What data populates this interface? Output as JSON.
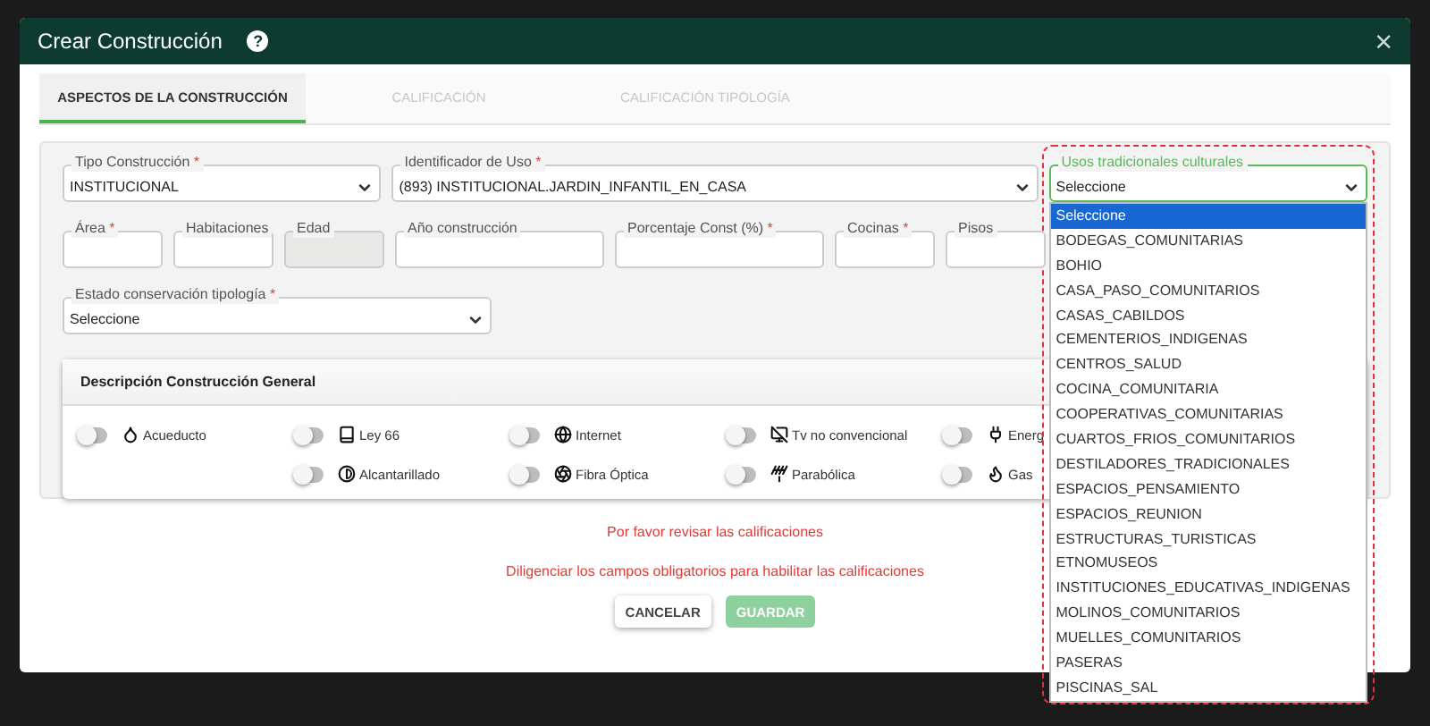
{
  "window": {
    "title": "Crear Construcción",
    "help": "?",
    "close": "×"
  },
  "tabs": [
    {
      "label": "ASPECTOS DE LA CONSTRUCCIÓN",
      "selected": true,
      "disabled": false
    },
    {
      "label": "CALIFICACIÓN",
      "selected": false,
      "disabled": true
    },
    {
      "label": "CALIFICACIÓN TIPOLOGÍA",
      "selected": false,
      "disabled": true
    }
  ],
  "field_rows": [
    [
      {
        "kind": "select",
        "label": "Tipo Construcción",
        "required": true,
        "value": "INSTITUCIONAL",
        "disabled": false,
        "focused": false
      },
      {
        "kind": "select",
        "label": "Identificador de Uso",
        "required": true,
        "value": "(893) INSTITUCIONAL.JARDIN_INFANTIL_EN_CASA",
        "disabled": false,
        "focused": false
      },
      {
        "kind": "select",
        "label": "Usos tradicionales culturales",
        "required": false,
        "value": "Seleccione",
        "disabled": false,
        "focused": true
      }
    ],
    [
      {
        "kind": "input",
        "label": "Área",
        "required": true,
        "disabled": false,
        "focused": false
      },
      {
        "kind": "input",
        "label": "Habitaciones",
        "required": false,
        "disabled": false,
        "focused": false
      },
      {
        "kind": "input",
        "label": "Edad",
        "required": false,
        "disabled": true,
        "focused": false
      },
      {
        "kind": "input",
        "label": "Año construcción",
        "required": false,
        "disabled": false,
        "focused": false
      },
      {
        "kind": "input",
        "label": "Porcentaje Const (%)",
        "required": true,
        "disabled": false,
        "focused": false
      },
      {
        "kind": "input",
        "label": "Cocinas",
        "required": true,
        "disabled": false,
        "focused": false
      },
      {
        "kind": "input",
        "label": "Pisos",
        "required": false,
        "disabled": false,
        "focused": false
      }
    ],
    [
      {
        "kind": "select",
        "label": "Estado conservación tipología",
        "required": true,
        "value": "Seleccione",
        "disabled": false,
        "focused": false
      }
    ]
  ],
  "required_mark": "*",
  "dropdown": {
    "options": [
      {
        "label": "Seleccione",
        "selected": true
      },
      {
        "label": "BODEGAS_COMUNITARIAS",
        "selected": false
      },
      {
        "label": "BOHIO",
        "selected": false
      },
      {
        "label": "CASA_PASO_COMUNITARIOS",
        "selected": false
      },
      {
        "label": "CASAS_CABILDOS",
        "selected": false
      },
      {
        "label": "CEMENTERIOS_INDIGENAS",
        "selected": false
      },
      {
        "label": "CENTROS_SALUD",
        "selected": false
      },
      {
        "label": "COCINA_COMUNITARIA",
        "selected": false
      },
      {
        "label": "COOPERATIVAS_COMUNITARIAS",
        "selected": false
      },
      {
        "label": "CUARTOS_FRIOS_COMUNITARIOS",
        "selected": false
      },
      {
        "label": "DESTILADORES_TRADICIONALES",
        "selected": false
      },
      {
        "label": "ESPACIOS_PENSAMIENTO",
        "selected": false
      },
      {
        "label": "ESPACIOS_REUNION",
        "selected": false
      },
      {
        "label": "ESTRUCTURAS_TURISTICAS",
        "selected": false
      },
      {
        "label": "ETNOMUSEOS",
        "selected": false
      },
      {
        "label": "INSTITUCIONES_EDUCATIVAS_INDIGENAS",
        "selected": false
      },
      {
        "label": "MOLINOS_COMUNITARIOS",
        "selected": false
      },
      {
        "label": "MUELLES_COMUNITARIOS",
        "selected": false
      },
      {
        "label": "PASERAS",
        "selected": false
      },
      {
        "label": "PISCINAS_SAL",
        "selected": false
      }
    ]
  },
  "services": {
    "title": "Descripción Construcción General",
    "rows": [
      [
        {
          "label": "Acueducto",
          "on": false
        },
        {
          "label": "Ley 66",
          "on": false
        },
        {
          "label": "Internet",
          "on": false
        },
        {
          "label": "Tv no convencional",
          "on": false
        },
        {
          "label": "Energ",
          "on": false
        }
      ],
      [
        "",
        {
          "label": "Alcantarillado",
          "on": false
        },
        {
          "label": "Fibra Óptica",
          "on": false
        },
        {
          "label": "Parabólica",
          "on": false
        },
        {
          "label": "Gas",
          "on": false
        }
      ]
    ]
  },
  "messages": [
    "Por favor revisar las calificaciones",
    "Diligenciar los campos obligatorios para habilitar las calificaciones"
  ],
  "buttons": [
    {
      "label": "CANCELAR",
      "kind": "secondary",
      "disabled": false
    },
    {
      "label": "GUARDAR",
      "kind": "primary",
      "disabled": true
    }
  ]
}
